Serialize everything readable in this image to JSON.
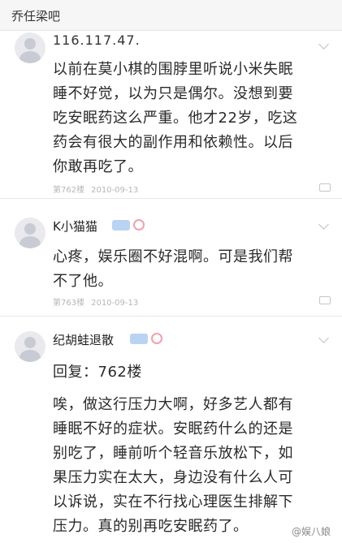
{
  "header": {
    "title": "乔任梁吧"
  },
  "posts": [
    {
      "ip_text": "116.117.47.",
      "lines": [
        "以前在莫小棋的围脖里听说小米失眠",
        "睡不好觉，以为只是偶尔。没想到要",
        "吃安眠药这么严重。他才22岁，吃这",
        "药会有很大的副作用和依赖性。以后",
        "你敢再吃了。"
      ],
      "floor": "第762楼",
      "date": "2010-09-13"
    },
    {
      "username": "K小猫猫",
      "lines": [
        "心疼，娱乐圈不好混啊。可是我们帮",
        "不了他。"
      ],
      "floor": "第763楼",
      "date": "2010-09-13"
    },
    {
      "username": "纪胡蛙退散",
      "reply_to": "回复：762楼",
      "lines": [
        "唉，做这行压力大啊，好多艺人都有",
        "睡眠不好的症状。安眠药什么的还是",
        "别吃了，睡前听个轻音乐放松下，如",
        "果压力实在太大，身边没有什么人可",
        "以诉说，实在不行找心理医生排解下",
        "压力。真的别再吃安眠药了。"
      ]
    }
  ],
  "watermark": "@娱八娘",
  "icons": {
    "avatar": "default-avatar-icon",
    "more": "chevron-down-icon",
    "comment": "comment-icon",
    "level": "level-badge-icon",
    "emblem": "member-badge-icon"
  }
}
